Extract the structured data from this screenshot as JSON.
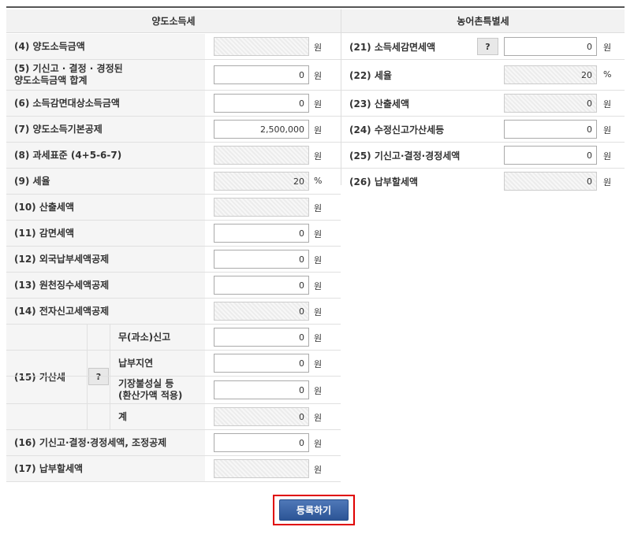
{
  "headers": {
    "left": "양도소득세",
    "right": "농어촌특별세"
  },
  "rows_left": [
    {
      "label": "(4) 양도소득금액",
      "value": "",
      "unit": "원"
    },
    {
      "label": "(5) 기신고 · 결정 · 경정된\n양도소득금액 합계",
      "value": "0",
      "unit": "원"
    },
    {
      "label": "(6) 소득감면대상소득금액",
      "value": "0",
      "unit": "원"
    },
    {
      "label": "(7) 양도소득기본공제",
      "value": "2,500,000",
      "unit": "원"
    },
    {
      "label": "(8) 과세표준 (4+5-6-7)",
      "value": "",
      "unit": "원"
    },
    {
      "label": "(9) 세율",
      "value": "20",
      "unit": "%"
    },
    {
      "label": "(10) 산출세액",
      "value": "",
      "unit": "원"
    },
    {
      "label": "(11) 감면세액",
      "value": "0",
      "unit": "원"
    },
    {
      "label": "(12) 외국납부세액공제",
      "value": "0",
      "unit": "원"
    },
    {
      "label": "(13) 원천징수세액공제",
      "value": "0",
      "unit": "원"
    },
    {
      "label": "(14) 전자신고세액공제",
      "value": "0",
      "unit": "원"
    }
  ],
  "gasan": {
    "label": "(15) 가산세",
    "help": "?",
    "sub": [
      {
        "label": "무(과소)신고",
        "value": "0",
        "unit": "원"
      },
      {
        "label": "납부지연",
        "value": "0",
        "unit": "원"
      },
      {
        "label": "기장불성실 등\n(환산가액 적용)",
        "value": "0",
        "unit": "원"
      },
      {
        "label": "계",
        "value": "0",
        "unit": "원"
      }
    ]
  },
  "rows_left_bottom": [
    {
      "label": "(16) 기신고·결정·경정세액, 조정공제",
      "value": "0",
      "unit": "원"
    },
    {
      "label": "(17) 납부할세액",
      "value": "",
      "unit": "원"
    }
  ],
  "rows_right": [
    {
      "label": "(21) 소득세감면세액",
      "help": "?",
      "value": "0",
      "unit": "원"
    },
    {
      "label": "(22) 세율",
      "value": "20",
      "unit": "%"
    },
    {
      "label": "(23) 산출세액",
      "value": "0",
      "unit": "원"
    },
    {
      "label": "(24) 수정신고가산세등",
      "value": "0",
      "unit": "원"
    },
    {
      "label": "(25) 기신고·결정·경정세액",
      "value": "0",
      "unit": "원"
    },
    {
      "label": "(26) 납부할세액",
      "value": "0",
      "unit": "원"
    }
  ],
  "submit_label": "등록하기"
}
